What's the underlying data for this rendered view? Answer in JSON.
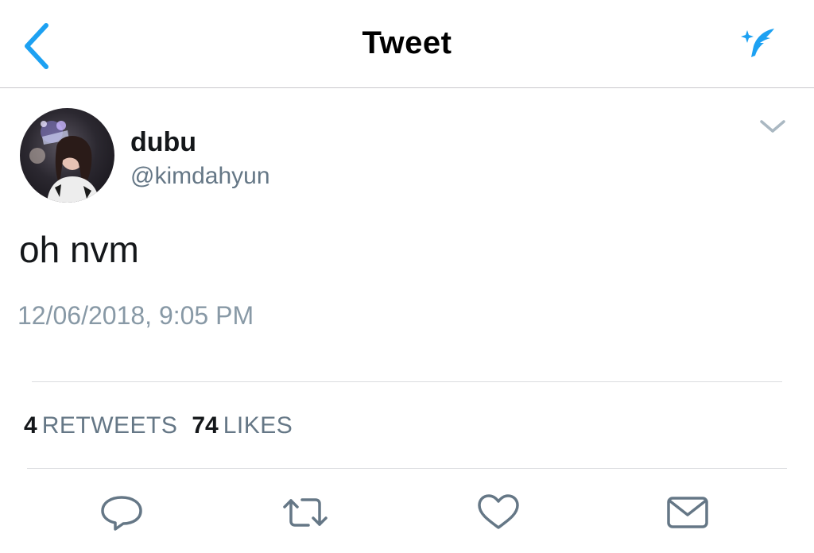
{
  "nav": {
    "title": "Tweet",
    "back_icon": "chevron-left-icon",
    "compose_icon": "compose-tweet-icon",
    "accent_color": "#1da1f2"
  },
  "tweet": {
    "display_name": "dubu",
    "handle": "@kimdahyun",
    "text": "oh nvm",
    "timestamp": "12/06/2018, 9:05 PM",
    "more_icon": "chevron-down-icon"
  },
  "stats": {
    "retweets_count": "4",
    "retweets_label": "RETWEETS",
    "likes_count": "74",
    "likes_label": "LIKES"
  },
  "actions": [
    {
      "name": "reply",
      "icon": "reply-icon"
    },
    {
      "name": "retweet",
      "icon": "retweet-icon"
    },
    {
      "name": "like",
      "icon": "heart-icon"
    },
    {
      "name": "direct-message",
      "icon": "envelope-icon"
    }
  ],
  "colors": {
    "text_primary": "#14171a",
    "text_secondary": "#657786",
    "timestamp": "#8899a6",
    "icon_gray": "#657786"
  }
}
